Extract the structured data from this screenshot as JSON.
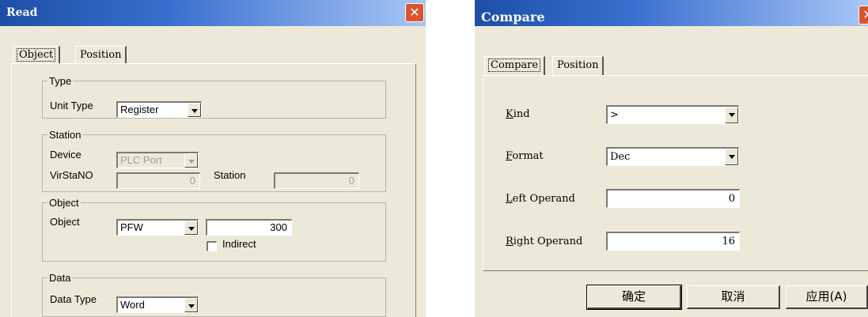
{
  "read": {
    "title": "Read",
    "tabs": [
      "Object",
      "Position"
    ],
    "type_group": {
      "legend": "Type",
      "unit_type_label": "Unit Type",
      "unit_type_value": "Register"
    },
    "station_group": {
      "legend": "Station",
      "device_label": "Device",
      "device_value": "PLC Port",
      "virstano_label": "VirStaNO",
      "virstano_value": "0",
      "station_label": "Station",
      "station_value": "0"
    },
    "object_group": {
      "legend": "Object",
      "object_label": "Object",
      "object_value": "PFW",
      "address_value": "300",
      "indirect_label": "Indirect"
    },
    "data_group": {
      "legend": "Data",
      "data_type_label": "Data Type",
      "data_type_value": "Word"
    }
  },
  "compare": {
    "title": "Compare",
    "tabs": [
      "Compare",
      "Position"
    ],
    "kind_label_first": "K",
    "kind_label_rest": "ind",
    "kind_value": ">",
    "format_label_first": "F",
    "format_label_rest": "ormat",
    "format_value": "Dec",
    "left_label_first": "L",
    "left_label_rest": "eft Operand",
    "left_value": "0",
    "right_label_first": "R",
    "right_label_rest": "ight Operand",
    "right_value": "16",
    "buttons": {
      "ok": "确定",
      "cancel": "取消",
      "apply": "应用(A)"
    }
  },
  "colors": {
    "dialog_bg": "#ece9d8",
    "title_start": "#1d4fa6",
    "title_end": "#a6c6f4",
    "close_red": "#d9542f"
  }
}
